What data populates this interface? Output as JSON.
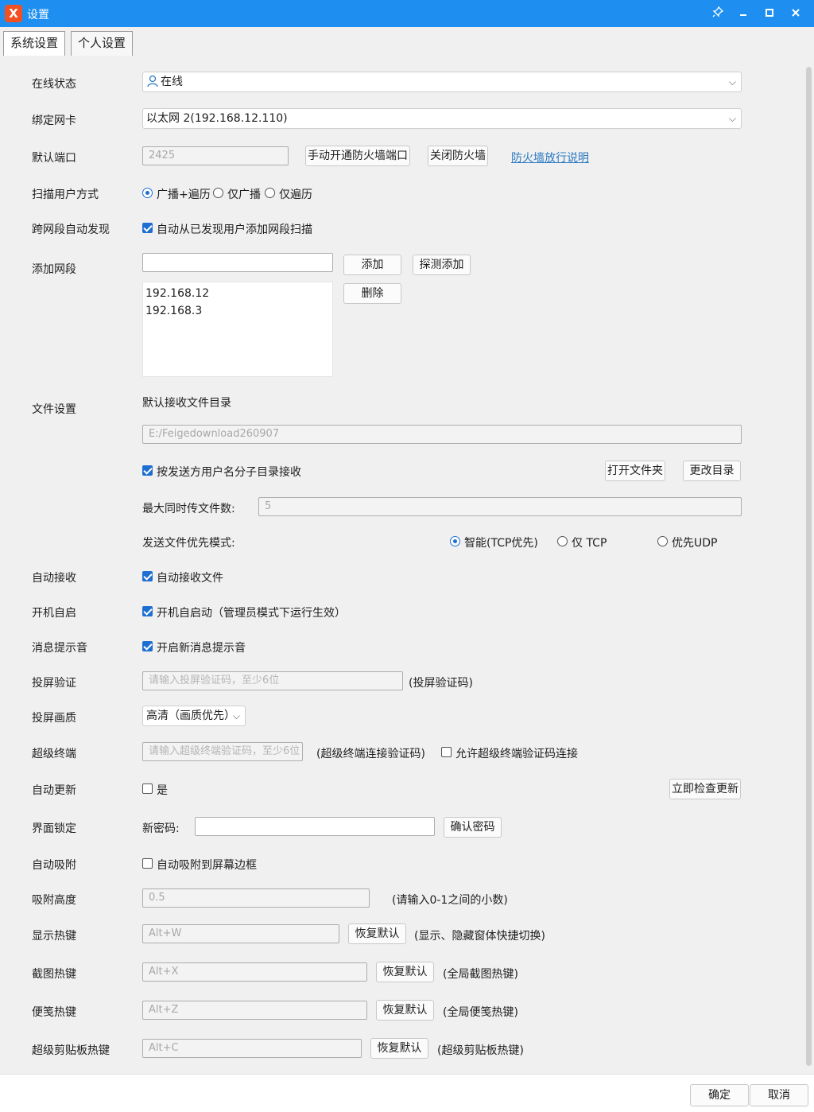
{
  "window": {
    "title": "设置",
    "logo_text": "X"
  },
  "tabs": [
    "系统设置",
    "个人设置"
  ],
  "labels": {
    "status": "在线状态",
    "nic": "绑定网卡",
    "port": "默认端口",
    "scan_mode": "扫描用户方式",
    "cross_seg": "跨网段自动发现",
    "add_seg": "添加网段",
    "file_settings": "文件设置",
    "auto_recv": "自动接收",
    "autostart": "开机自启",
    "msg_sound": "消息提示音",
    "cast_verify": "投屏验证",
    "cast_quality": "投屏画质",
    "super_term": "超级终端",
    "auto_update": "自动更新",
    "ui_lock": "界面锁定",
    "auto_snap": "自动吸附",
    "snap_height": "吸附高度",
    "show_hotkey": "显示热键",
    "screenshot_hotkey": "截图热键",
    "note_hotkey": "便笺热键",
    "clipboard_hotkey": "超级剪贴板热键"
  },
  "status_select": {
    "value": "在线"
  },
  "nic_select": {
    "value": "以太网 2(192.168.12.110)"
  },
  "port": {
    "value": "2425",
    "open_fw_btn": "手动开通防火墙端口",
    "close_fw_btn": "关闭防火墙",
    "fw_link": "防火墙放行说明"
  },
  "scan": {
    "options": [
      "广播+遍历",
      "仅广播",
      "仅遍历"
    ],
    "selected": 0
  },
  "cross_seg": {
    "text": "自动从已发现用户添加网段扫描",
    "checked": true
  },
  "segments": {
    "input_value": "",
    "add_btn": "添加",
    "probe_btn": "探测添加",
    "delete_btn": "删除",
    "items": [
      "192.168.12",
      "192.168.3"
    ]
  },
  "file": {
    "dir_label": "默认接收文件目录",
    "dir_value": "E:/Feigedownload260907",
    "subdir_text": "按发送方用户名分子目录接收",
    "subdir_checked": true,
    "open_folder_btn": "打开文件夹",
    "change_dir_btn": "更改目录",
    "max_files_label": "最大同时传文件数:",
    "max_files_value": "5",
    "priority_label": "发送文件优先模式:",
    "priority_options": [
      "智能(TCP优先)",
      "仅 TCP",
      "优先UDP"
    ],
    "priority_selected": 0
  },
  "auto_recv": {
    "text": "自动接收文件",
    "checked": true
  },
  "autostart": {
    "text": "开机自启动（管理员模式下运行生效）",
    "checked": true
  },
  "msg_sound": {
    "text": "开启新消息提示音",
    "checked": true
  },
  "cast_verify": {
    "placeholder": "请输入投屏验证码，至少6位",
    "note": "(投屏验证码)"
  },
  "cast_quality": {
    "value": "高清（画质优先）"
  },
  "super_term": {
    "placeholder": "请输入超级终端验证码，至少6位",
    "note": "(超级终端连接验证码)",
    "allow_text": "允许超级终端验证码连接",
    "allow_checked": false
  },
  "auto_update": {
    "text": "是",
    "checked": false,
    "check_btn": "立即检查更新"
  },
  "ui_lock": {
    "pwd_label": "新密码:",
    "pwd_value": "",
    "confirm_btn": "确认密码"
  },
  "auto_snap": {
    "text": "自动吸附到屏幕边框",
    "checked": false
  },
  "snap_height": {
    "value": "0.5",
    "note": "(请输入0-1之间的小数)"
  },
  "hotkeys": {
    "reset_label": "恢复默认",
    "show": {
      "value": "Alt+W",
      "note": "(显示、隐藏窗体快捷切换)"
    },
    "screenshot": {
      "value": "Alt+X",
      "note": "(全局截图热键)"
    },
    "note": {
      "value": "Alt+Z",
      "note": "(全局便笺热键)"
    },
    "clipboard": {
      "value": "Alt+C",
      "note": "(超级剪贴板热键)"
    }
  },
  "footer": {
    "ok": "确定",
    "cancel": "取消"
  },
  "colors": {
    "titlebar": "#1e8ff0",
    "accent": "#1e6fd0",
    "link": "#2b79c2",
    "logo": "#f25022"
  }
}
